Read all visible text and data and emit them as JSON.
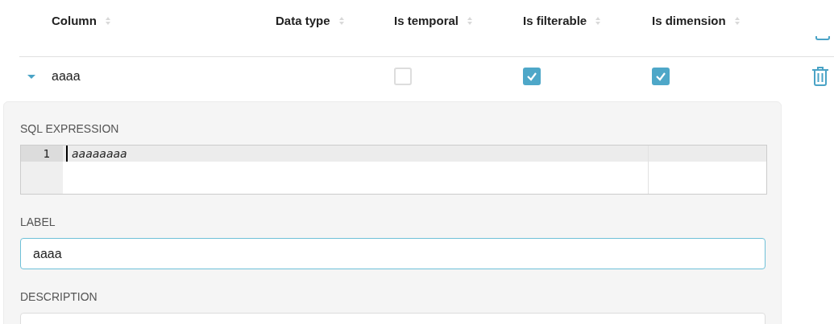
{
  "table": {
    "columns": [
      {
        "label": "Column"
      },
      {
        "label": "Data type"
      },
      {
        "label": "Is temporal"
      },
      {
        "label": "Is filterable"
      },
      {
        "label": "Is dimension"
      }
    ],
    "rows": [
      {
        "expanded": true,
        "column": "aaaa",
        "is_temporal": false,
        "is_filterable": true,
        "is_dimension": true
      }
    ]
  },
  "details": {
    "sql_expression": {
      "label": "SQL EXPRESSION",
      "lines": [
        {
          "number": "1",
          "code": "aaaaaaaa"
        }
      ]
    },
    "label_field": {
      "label": "LABEL",
      "value": "aaaa"
    },
    "description_field": {
      "label": "DESCRIPTION"
    }
  }
}
